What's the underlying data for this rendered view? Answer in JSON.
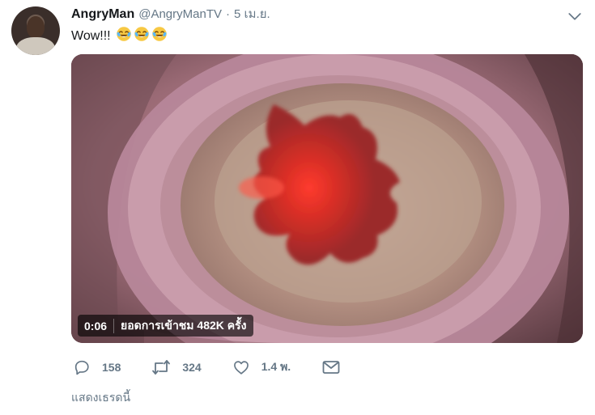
{
  "tweet": {
    "display_name": "AngryMan",
    "handle": "@AngryManTV",
    "separator": "·",
    "time": "5 เม.ย.",
    "text": "Wow!!!",
    "emojis": [
      "face-with-tears-of-joy",
      "face-with-tears-of-joy",
      "face-with-tears-of-joy"
    ]
  },
  "video": {
    "duration": "0:06",
    "views": "ยอดการเข้าชม 482K ครั้ง"
  },
  "actions": {
    "reply_count": "158",
    "retweet_count": "324",
    "like_count": "1.4 พ."
  },
  "thread_link": "แสดงเธรดนี้",
  "colors": {
    "secondary_text": "#657786",
    "primary_text": "#14171a",
    "video_badge_bg": "rgba(0,0,0,0.62)",
    "video_red": "#ff3a2f"
  },
  "icons": {
    "menu": "chevron-down-icon",
    "reply": "reply-icon",
    "retweet": "retweet-icon",
    "like": "heart-icon",
    "dm": "envelope-icon"
  }
}
